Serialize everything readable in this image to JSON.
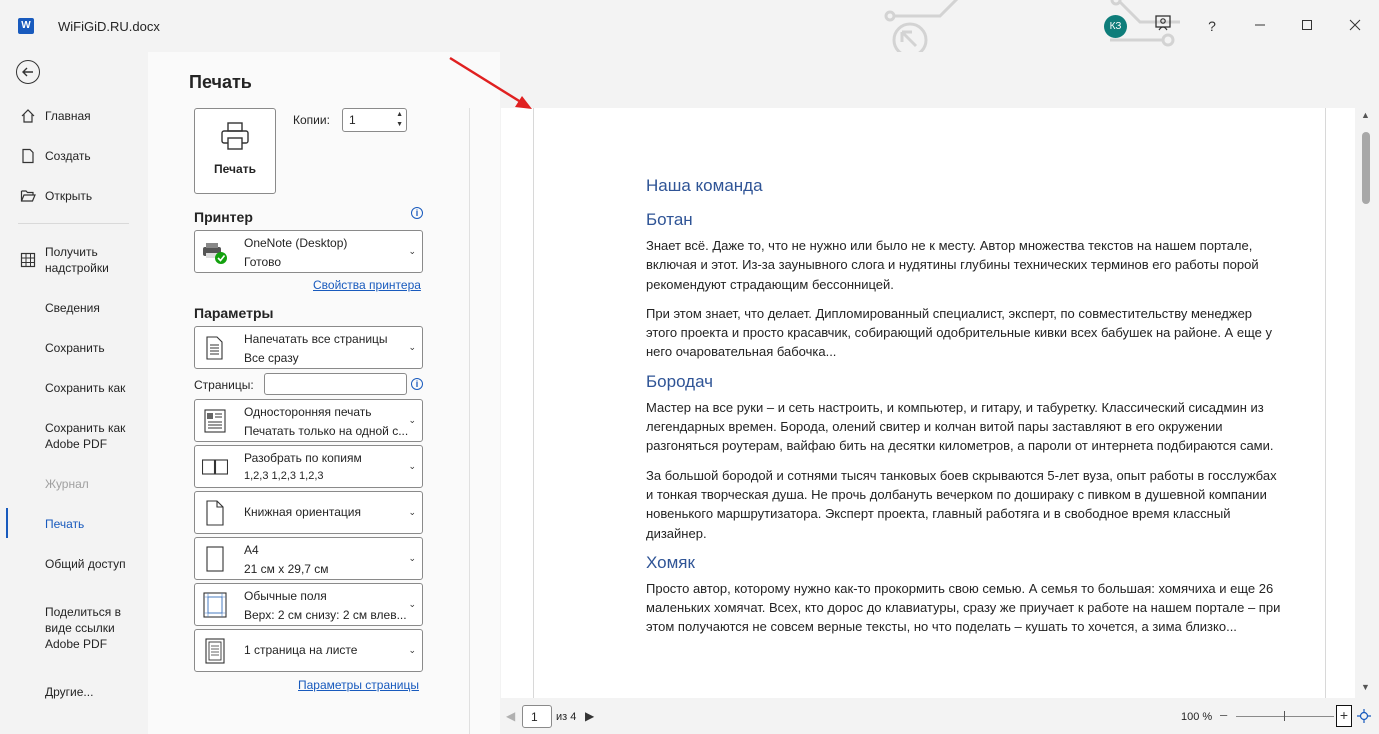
{
  "window": {
    "app_icon": "word-icon",
    "title": "WiFiGiD.RU.docx",
    "avatar_initials": "КЗ",
    "buttons": [
      "feedback-icon",
      "help-icon",
      "minimize-icon",
      "maximize-icon",
      "close-icon"
    ],
    "help_label": "?"
  },
  "nav": {
    "items": [
      {
        "label": "Главная",
        "icon": "home-icon"
      },
      {
        "label": "Создать",
        "icon": "new-document-icon"
      },
      {
        "label": "Открыть",
        "icon": "folder-open-icon"
      },
      {
        "label": "Получить надстройки",
        "icon": "addins-grid-icon"
      },
      {
        "label": "Сведения"
      },
      {
        "label": "Сохранить"
      },
      {
        "label": "Сохранить как"
      },
      {
        "label": "Сохранить как Adobe PDF"
      },
      {
        "label": "Журнал",
        "state": "disabled"
      },
      {
        "label": "Печать",
        "state": "active"
      },
      {
        "label": "Общий доступ"
      },
      {
        "label": "Поделиться в виде ссылки Adobe PDF"
      },
      {
        "label": "Другие..."
      }
    ]
  },
  "print_panel": {
    "title": "Печать",
    "print_button": "Печать",
    "copies_label": "Копии:",
    "copies_value": "1",
    "printer_heading": "Принтер",
    "printer_name": "OneNote (Desktop)",
    "printer_status": "Готово",
    "printer_properties_link": "Свойства принтера",
    "settings_heading": "Параметры",
    "pages_label": "Страницы:",
    "pages_value": "",
    "settings": [
      {
        "line1": "Напечатать все страницы",
        "line2": "Все сразу"
      },
      {
        "line1": "Односторонняя печать",
        "line2": "Печатать только на одной с..."
      },
      {
        "line1": "Разобрать по копиям",
        "line2": "1,2,3    1,2,3    1,2,3"
      },
      {
        "line1": "Книжная ориентация"
      },
      {
        "line1": "A4",
        "line2": "21 см x 29,7 см"
      },
      {
        "line1": "Обычные поля",
        "line2": "Верх: 2 см снизу: 2 см влев..."
      },
      {
        "line1": "1 страница на листе"
      }
    ],
    "page_setup_link": "Параметры страницы"
  },
  "preview": {
    "document": {
      "title": "Наша команда",
      "sections": [
        {
          "heading": "Ботан",
          "paragraphs": [
            "Знает всё. Даже то, что не нужно или было не к месту. Автор множества текстов на нашем портале, включая и этот. Из-за заунывного слога и нудятины глубины технических терминов его работы порой рекомендуют страдающим бессонницей.",
            "При этом знает, что делает. Дипломированный специалист, эксперт, по совместительству менеджер этого проекта и просто красавчик, собирающий одобрительные кивки всех бабушек на районе. А еще у него очаровательная бабочка..."
          ]
        },
        {
          "heading": "Бородач",
          "paragraphs": [
            "Мастер на все руки – и сеть настроить, и компьютер, и гитару, и табуретку. Классический сисадмин из легендарных времен. Борода, олений свитер и колчан витой пары заставляют в его окружении разгоняться роутерам, вайфаю бить на десятки километров, а пароли от интернета подбираются сами.",
            "За большой бородой и сотнями тысяч танковых боев скрываются 5-лет вуза, опыт работы в госслужбах и тонкая творческая душа. Не прочь долбануть вечерком по доширaку с пивком в душевной компании новенького маршрутизатора. Эксперт проекта, главный работяга и в свободное время классный дизайнер."
          ]
        },
        {
          "heading": "Хомяк",
          "paragraphs": [
            "Просто автор, которому нужно как-то прокормить свою семью. А семья то большая: хомячиха и еще 26 маленьких хомячат. Всех, кто дорос до клавиатуры, сразу же приучает к работе на нашем портале – при этом получаются не совсем верные тексты, но что поделать – кушать то хочется, а зима близко..."
          ]
        }
      ]
    },
    "current_page": "1",
    "page_of": "из 4",
    "zoom": "100 %",
    "zoom_level_percent": 100
  },
  "colors": {
    "accent": "#185abd",
    "heading": "#2f5496",
    "annotation_arrow": "#e02020"
  }
}
